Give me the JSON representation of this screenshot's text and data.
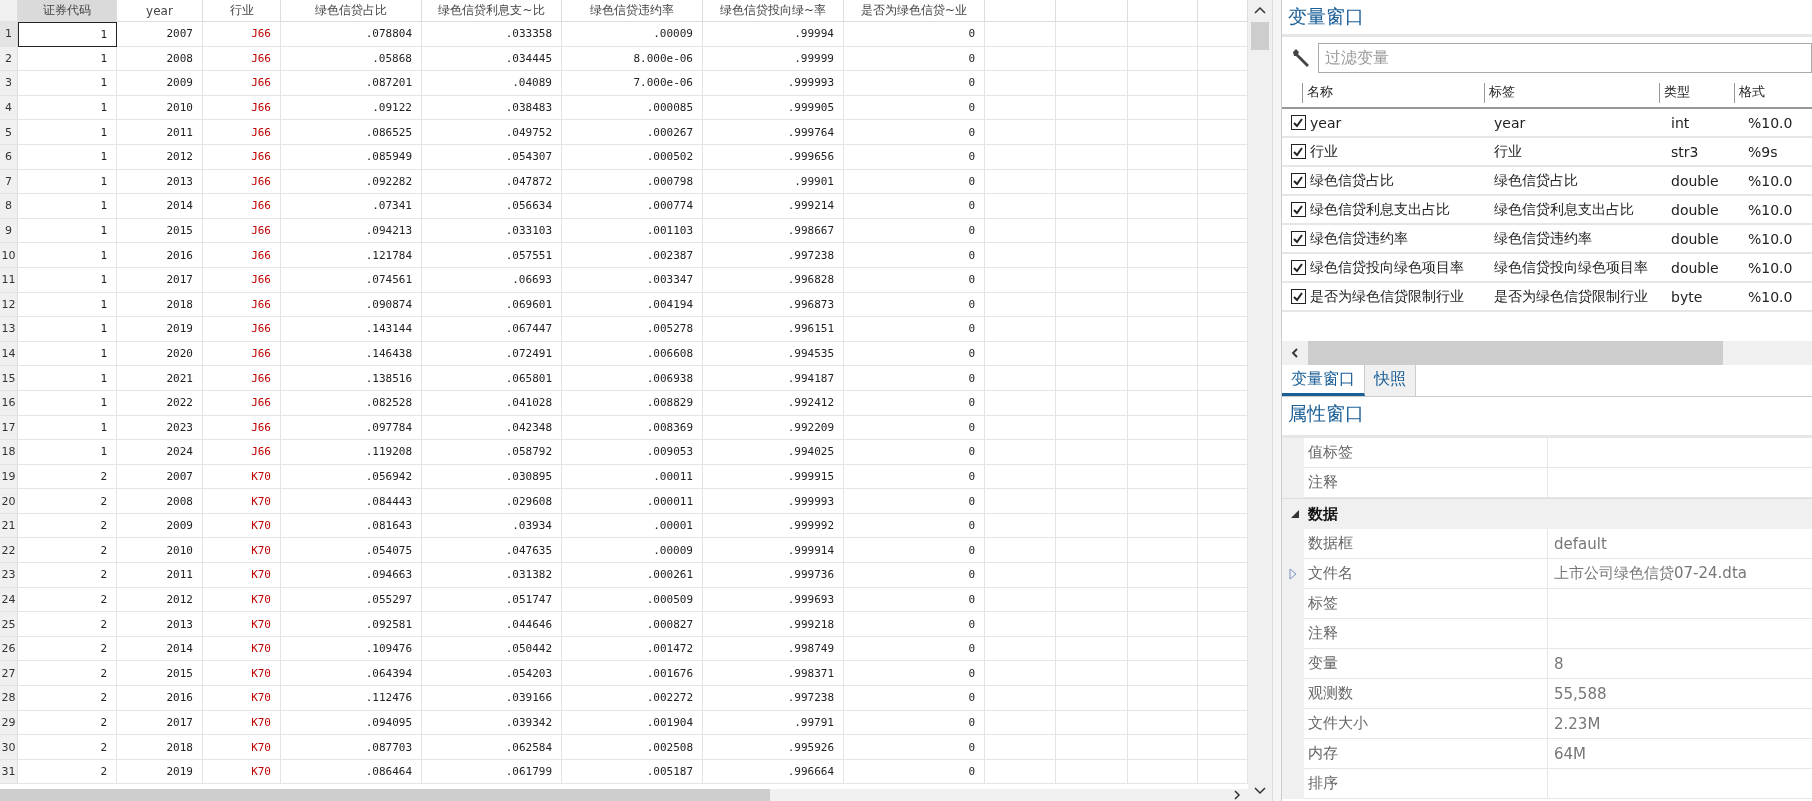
{
  "data_editor": {
    "columns": [
      {
        "label": "证券代码",
        "kind": "numeric",
        "selected": true
      },
      {
        "label": "year",
        "kind": "numeric",
        "selected": false
      },
      {
        "label": "行业",
        "kind": "string",
        "selected": false
      },
      {
        "label": "绿色信贷占比",
        "kind": "numeric",
        "selected": false
      },
      {
        "label": "绿色信贷利息支~比",
        "kind": "numeric",
        "selected": false
      },
      {
        "label": "绿色信贷违约率",
        "kind": "numeric",
        "selected": false
      },
      {
        "label": "绿色信贷投向绿~率",
        "kind": "numeric",
        "selected": false
      },
      {
        "label": "是否为绿色信贷~业",
        "kind": "numeric",
        "selected": false
      }
    ],
    "rows": [
      {
        "num": "1",
        "selected": true,
        "cells": [
          "1",
          "2007",
          "J66",
          ".078804",
          ".033358",
          ".00009",
          ".99994",
          "0"
        ]
      },
      {
        "num": "2",
        "selected": false,
        "cells": [
          "1",
          "2008",
          "J66",
          ".05868",
          ".034445",
          "8.000e-06",
          ".99999",
          "0"
        ]
      },
      {
        "num": "3",
        "selected": false,
        "cells": [
          "1",
          "2009",
          "J66",
          ".087201",
          ".04089",
          "7.000e-06",
          ".999993",
          "0"
        ]
      },
      {
        "num": "4",
        "selected": false,
        "cells": [
          "1",
          "2010",
          "J66",
          ".09122",
          ".038483",
          ".000085",
          ".999905",
          "0"
        ]
      },
      {
        "num": "5",
        "selected": false,
        "cells": [
          "1",
          "2011",
          "J66",
          ".086525",
          ".049752",
          ".000267",
          ".999764",
          "0"
        ]
      },
      {
        "num": "6",
        "selected": false,
        "cells": [
          "1",
          "2012",
          "J66",
          ".085949",
          ".054307",
          ".000502",
          ".999656",
          "0"
        ]
      },
      {
        "num": "7",
        "selected": false,
        "cells": [
          "1",
          "2013",
          "J66",
          ".092282",
          ".047872",
          ".000798",
          ".99901",
          "0"
        ]
      },
      {
        "num": "8",
        "selected": false,
        "cells": [
          "1",
          "2014",
          "J66",
          ".07341",
          ".056634",
          ".000774",
          ".999214",
          "0"
        ]
      },
      {
        "num": "9",
        "selected": false,
        "cells": [
          "1",
          "2015",
          "J66",
          ".094213",
          ".033103",
          ".001103",
          ".998667",
          "0"
        ]
      },
      {
        "num": "10",
        "selected": false,
        "cells": [
          "1",
          "2016",
          "J66",
          ".121784",
          ".057551",
          ".002387",
          ".997238",
          "0"
        ]
      },
      {
        "num": "11",
        "selected": false,
        "cells": [
          "1",
          "2017",
          "J66",
          ".074561",
          ".06693",
          ".003347",
          ".996828",
          "0"
        ]
      },
      {
        "num": "12",
        "selected": false,
        "cells": [
          "1",
          "2018",
          "J66",
          ".090874",
          ".069601",
          ".004194",
          ".996873",
          "0"
        ]
      },
      {
        "num": "13",
        "selected": false,
        "cells": [
          "1",
          "2019",
          "J66",
          ".143144",
          ".067447",
          ".005278",
          ".996151",
          "0"
        ]
      },
      {
        "num": "14",
        "selected": false,
        "cells": [
          "1",
          "2020",
          "J66",
          ".146438",
          ".072491",
          ".006608",
          ".994535",
          "0"
        ]
      },
      {
        "num": "15",
        "selected": false,
        "cells": [
          "1",
          "2021",
          "J66",
          ".138516",
          ".065801",
          ".006938",
          ".994187",
          "0"
        ]
      },
      {
        "num": "16",
        "selected": false,
        "cells": [
          "1",
          "2022",
          "J66",
          ".082528",
          ".041028",
          ".008829",
          ".992412",
          "0"
        ]
      },
      {
        "num": "17",
        "selected": false,
        "cells": [
          "1",
          "2023",
          "J66",
          ".097784",
          ".042348",
          ".008369",
          ".992209",
          "0"
        ]
      },
      {
        "num": "18",
        "selected": false,
        "cells": [
          "1",
          "2024",
          "J66",
          ".119208",
          ".058792",
          ".009053",
          ".994025",
          "0"
        ]
      },
      {
        "num": "19",
        "selected": false,
        "cells": [
          "2",
          "2007",
          "K70",
          ".056942",
          ".030895",
          ".00011",
          ".999915",
          "0"
        ]
      },
      {
        "num": "20",
        "selected": false,
        "cells": [
          "2",
          "2008",
          "K70",
          ".084443",
          ".029608",
          ".000011",
          ".999993",
          "0"
        ]
      },
      {
        "num": "21",
        "selected": false,
        "cells": [
          "2",
          "2009",
          "K70",
          ".081643",
          ".03934",
          ".00001",
          ".999992",
          "0"
        ]
      },
      {
        "num": "22",
        "selected": false,
        "cells": [
          "2",
          "2010",
          "K70",
          ".054075",
          ".047635",
          ".00009",
          ".999914",
          "0"
        ]
      },
      {
        "num": "23",
        "selected": false,
        "cells": [
          "2",
          "2011",
          "K70",
          ".094663",
          ".031382",
          ".000261",
          ".999736",
          "0"
        ]
      },
      {
        "num": "24",
        "selected": false,
        "cells": [
          "2",
          "2012",
          "K70",
          ".055297",
          ".051747",
          ".000509",
          ".999693",
          "0"
        ]
      },
      {
        "num": "25",
        "selected": false,
        "cells": [
          "2",
          "2013",
          "K70",
          ".092581",
          ".044646",
          ".000827",
          ".999218",
          "0"
        ]
      },
      {
        "num": "26",
        "selected": false,
        "cells": [
          "2",
          "2014",
          "K70",
          ".109476",
          ".050442",
          ".001472",
          ".998749",
          "0"
        ]
      },
      {
        "num": "27",
        "selected": false,
        "cells": [
          "2",
          "2015",
          "K70",
          ".064394",
          ".054203",
          ".001676",
          ".998371",
          "0"
        ]
      },
      {
        "num": "28",
        "selected": false,
        "cells": [
          "2",
          "2016",
          "K70",
          ".112476",
          ".039166",
          ".002272",
          ".997238",
          "0"
        ]
      },
      {
        "num": "29",
        "selected": false,
        "cells": [
          "2",
          "2017",
          "K70",
          ".094095",
          ".039342",
          ".001904",
          ".99791",
          "0"
        ]
      },
      {
        "num": "30",
        "selected": false,
        "cells": [
          "2",
          "2018",
          "K70",
          ".087703",
          ".062584",
          ".002508",
          ".995926",
          "0"
        ]
      },
      {
        "num": "31",
        "selected": false,
        "cells": [
          "2",
          "2019",
          "K70",
          ".086464",
          ".061799",
          ".005187",
          ".996664",
          "0"
        ]
      }
    ]
  },
  "variables_panel": {
    "title": "变量窗口",
    "filter": {
      "placeholder": "过滤变量"
    },
    "columns": [
      "名称",
      "标签",
      "类型",
      "格式"
    ],
    "variables": [
      {
        "name": "year",
        "label": "year",
        "type": "int",
        "format": "%10.0",
        "checked": true
      },
      {
        "name": "行业",
        "label": "行业",
        "type": "str3",
        "format": "%9s",
        "checked": true
      },
      {
        "name": "绿色信贷占比",
        "label": "绿色信贷占比",
        "type": "double",
        "format": "%10.0",
        "checked": true
      },
      {
        "name": "绿色信贷利息支出占比",
        "label": "绿色信贷利息支出占比",
        "type": "double",
        "format": "%10.0",
        "checked": true
      },
      {
        "name": "绿色信贷违约率",
        "label": "绿色信贷违约率",
        "type": "double",
        "format": "%10.0",
        "checked": true
      },
      {
        "name": "绿色信贷投向绿色项目率",
        "label": "绿色信贷投向绿色项目率",
        "type": "double",
        "format": "%10.0",
        "checked": true
      },
      {
        "name": "是否为绿色信贷限制行业",
        "label": "是否为绿色信贷限制行业",
        "type": "byte",
        "format": "%10.0",
        "checked": true
      }
    ],
    "tabs": [
      {
        "label": "变量窗口",
        "selected": true
      },
      {
        "label": "快照",
        "selected": false
      }
    ]
  },
  "properties_panel": {
    "title": "属性窗口",
    "rows": [
      {
        "label": "值标签"
      },
      {
        "label": "注释"
      }
    ],
    "groups": [
      {
        "label": "数据",
        "expanded": true,
        "rows": [
          {
            "label": "数据框",
            "value": "default"
          },
          {
            "label": "文件名",
            "value": "上市公司绿色信贷07-24.dta",
            "expanded": false
          },
          {
            "label": "标签"
          },
          {
            "label": "注释"
          },
          {
            "label": "变量",
            "value": "8"
          },
          {
            "label": "观测数",
            "value": "55,588"
          },
          {
            "label": "文件大小",
            "value": "2.23M"
          },
          {
            "label": "内存",
            "value": "64M"
          },
          {
            "label": "排序"
          }
        ]
      }
    ]
  }
}
